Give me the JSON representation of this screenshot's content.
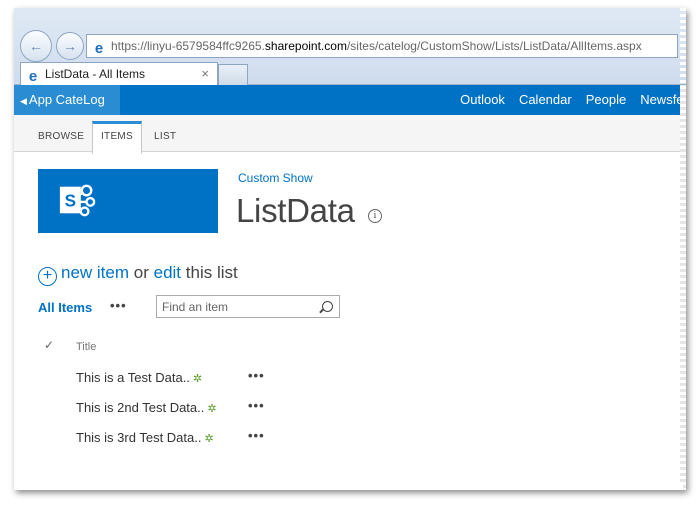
{
  "browser": {
    "url_prefix": "https://linyu-6579584ffc9265.",
    "url_host": "sharepoint.com",
    "url_path": "/sites/catelog/CustomShow/Lists/ListData/AllItems.aspx",
    "tab_title": "ListData - All Items",
    "tab_close": "×"
  },
  "suitebar": {
    "app_name": "App CateLog",
    "nav": [
      "Outlook",
      "Calendar",
      "People",
      "Newsfeed"
    ]
  },
  "ribbon": {
    "tabs": [
      "BROWSE",
      "ITEMS",
      "LIST"
    ]
  },
  "site": {
    "breadcrumb": "Custom Show",
    "title": "ListData"
  },
  "actions": {
    "new_item": "new item",
    "or": "or",
    "edit": "edit",
    "this_list": "this list"
  },
  "views": {
    "current": "All Items",
    "more": "•••",
    "search_placeholder": "Find an item"
  },
  "list": {
    "check_header": "✓",
    "title_header": "Title",
    "rows": [
      {
        "title": "This is a Test Data..",
        "new": "✲",
        "menu": "•••"
      },
      {
        "title": "This is 2nd Test Data..",
        "new": "✲",
        "menu": "•••"
      },
      {
        "title": "This is 3rd Test Data..",
        "new": "✲",
        "menu": "•••"
      }
    ]
  },
  "colors": {
    "suite_bar": "#0072c6",
    "accent": "#0072c6",
    "new_badge": "#5b9b28"
  }
}
